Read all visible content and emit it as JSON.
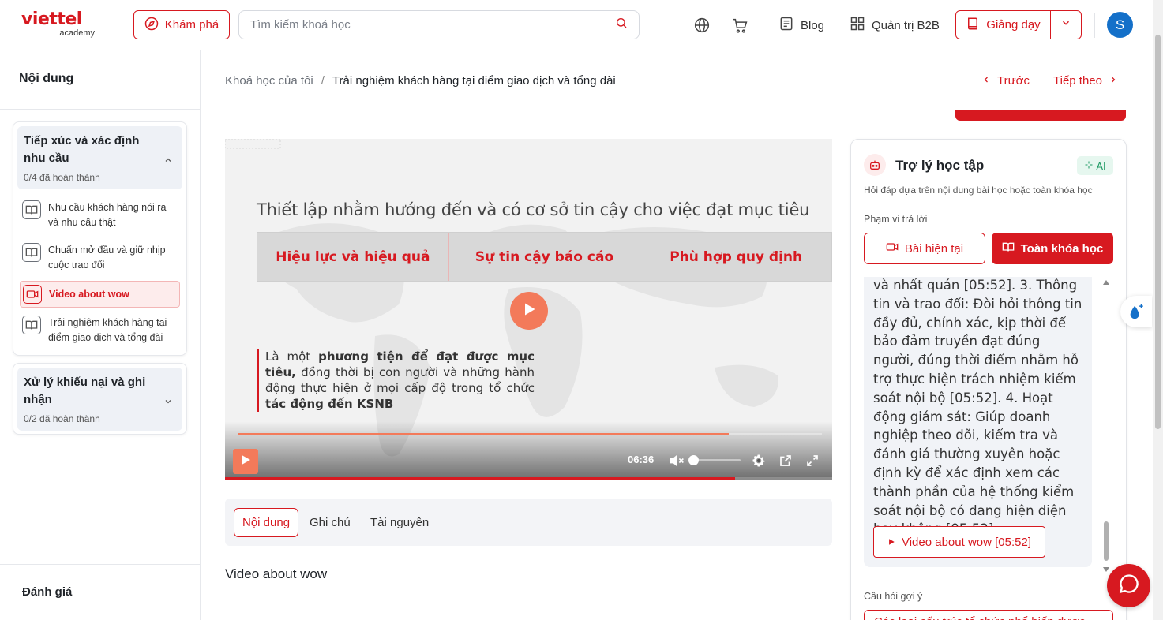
{
  "header": {
    "logo_brand": "viettel",
    "logo_sub": "academy",
    "explore_label": "Khám phá",
    "search_placeholder": "Tìm kiếm khoá học",
    "blog_label": "Blog",
    "b2b_label": "Quản trị B2B",
    "teach_label": "Giảng dạy",
    "avatar_initial": "S"
  },
  "sidebar": {
    "title": "Nội dung",
    "sections": [
      {
        "title": "Tiếp xúc và xác định nhu cầu",
        "progress": "0/4 đã hoàn thành",
        "expanded": true,
        "lessons": [
          {
            "label": "Nhu cầu khách hàng nói ra và nhu cầu thật",
            "icon": "book-icon"
          },
          {
            "label": "Chuẩn mở đầu và giữ nhịp cuộc trao đổi",
            "icon": "book-icon"
          },
          {
            "label": "Video about wow",
            "icon": "video-icon",
            "active": true
          },
          {
            "label": "Trải nghiệm khách hàng tại điểm giao dịch và tổng đài",
            "icon": "book-icon"
          }
        ]
      },
      {
        "title": "Xử lý khiếu nại và ghi nhận",
        "progress": "0/2 đã hoàn thành",
        "expanded": false
      }
    ],
    "evaluation_label": "Đánh giá"
  },
  "breadcrumb": {
    "parent": "Khoá học của tôi",
    "separator": "/",
    "current": "Trải nghiệm khách hàng tại điểm giao dịch và tổng đài"
  },
  "nav": {
    "prev_label": "Trước",
    "next_label": "Tiếp theo"
  },
  "video": {
    "slide_title": "Thiết lập nhằm hướng đến và có cơ sở tin cậy cho việc đạt mục tiêu",
    "boxes": [
      "Hiệu lực và hiệu quả",
      "Sự tin cậy báo cáo",
      "Phù hợp quy định"
    ],
    "quote_prefix": "Là một ",
    "quote_bold1": "phương tiện để đạt được mục tiêu,",
    "quote_middle": " đồng thời bị con người và những hành động thực hiện ở mọi cấp độ trong tổ chức ",
    "quote_bold2": "tác động đến KSNB",
    "time": "06:36",
    "progress_fraction": 0.84,
    "volume_fraction": 0.0
  },
  "tabs": [
    "Nội dung",
    "Ghi chú",
    "Tài nguyên"
  ],
  "lesson_heading": "Video about wow",
  "assistant": {
    "title": "Trợ lý học tập",
    "ai_badge": "AI",
    "description": "Hỏi đáp dựa trên nội dung bài học hoặc toàn khóa học",
    "scope_label": "Phạm vi trả lời",
    "scope_current": "Bài hiện tại",
    "scope_all": "Toàn khóa học",
    "answer_text": "và nhất quán [05:52]. 3. Thông tin và trao đổi: Đòi hỏi thông tin đầy đủ, chính xác, kịp thời để bảo đảm truyền đạt đúng người, đúng thời điểm nhằm hỗ trợ thực hiện trách nhiệm kiểm soát nội bộ [05:52]. 4. Hoạt động giám sát: Giúp doanh nghiệp theo dõi, kiểm tra và đánh giá thường xuyên hoặc định kỳ để xác định xem các thành phần của hệ thống kiểm soát nội bộ có đang hiện diện hay không [05:52].",
    "reference_label": "Video about wow [05:52]",
    "suggest_label": "Câu hỏi gợi ý",
    "suggest_chip": "Các loại cấu trúc tổ chức phổ biến được"
  },
  "colors": {
    "brand_red": "#d71920",
    "accent_orange": "#f37a5a",
    "ai_green": "#1d9a63",
    "avatar_blue": "#1470c9"
  }
}
